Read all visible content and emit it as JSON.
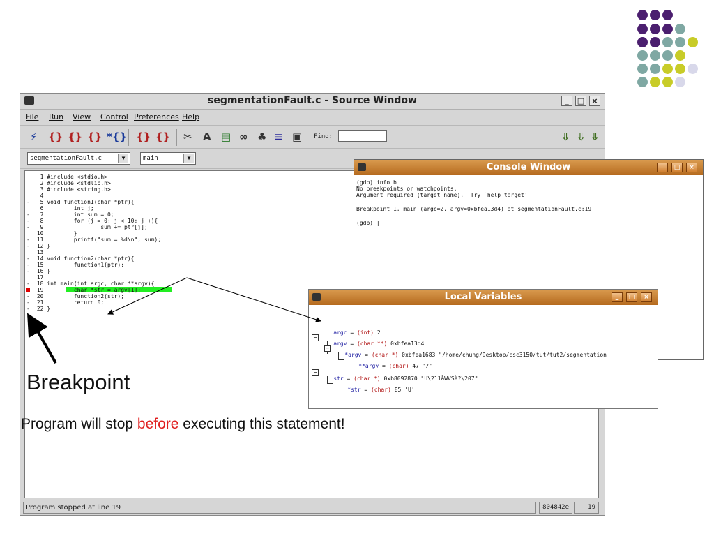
{
  "decor": {
    "colors": {
      "purple": "#4b1f6f",
      "teal": "#7fa8a3",
      "lime": "#c8cc28",
      "lavender": "#d8d8ea"
    }
  },
  "source_window": {
    "title": "segmentationFault.c - Source Window",
    "menu": [
      "File",
      "Run",
      "View",
      "Control",
      "Preferences",
      "Help"
    ],
    "find_label": "Find:",
    "file_combo": "segmentationFault.c",
    "function_combo": "main",
    "code": [
      {
        "marker": "",
        "text": "  1 #include <stdio.h>"
      },
      {
        "marker": "",
        "text": "  2 #include <stdlib.h>"
      },
      {
        "marker": "",
        "text": "  3 #include <string.h>"
      },
      {
        "marker": "",
        "text": "  4"
      },
      {
        "marker": "-",
        "text": "  5 void function1(char *ptr){"
      },
      {
        "marker": "",
        "text": "  6         int j;"
      },
      {
        "marker": "-",
        "text": "  7         int sum = 0;"
      },
      {
        "marker": "-",
        "text": "  8         for (j = 0; j < 10; j++){"
      },
      {
        "marker": "-",
        "text": "  9                 sum += ptr[j];"
      },
      {
        "marker": "",
        "text": " 10         }"
      },
      {
        "marker": "-",
        "text": " 11         printf(\"sum = %d\\n\", sum);"
      },
      {
        "marker": "-",
        "text": " 12 }"
      },
      {
        "marker": "",
        "text": " 13"
      },
      {
        "marker": "-",
        "text": " 14 void function2(char *ptr){"
      },
      {
        "marker": "-",
        "text": " 15         function1(ptr);"
      },
      {
        "marker": "-",
        "text": " 16 }"
      },
      {
        "marker": "",
        "text": " 17"
      },
      {
        "marker": "-",
        "text": " 18 int main(int argc, char **argv){"
      },
      {
        "marker": "bp",
        "text": " 19         char *str = argv[1];"
      },
      {
        "marker": "-",
        "text": " 20         function2(str);"
      },
      {
        "marker": "-",
        "text": " 21         return 0;"
      },
      {
        "marker": "-",
        "text": " 22 }"
      }
    ],
    "status_text": "Program stopped at line 19",
    "status_addr": "804842e",
    "status_line": "19"
  },
  "console_window": {
    "title": "Console Window",
    "lines": [
      "(gdb) info b",
      "No breakpoints or watchpoints.",
      "Argument required (target name).  Try `help target'",
      "",
      "Breakpoint 1, main (argc=2, argv=0xbfea13d4) at segmentationFault.c:19",
      "",
      "(gdb) |"
    ]
  },
  "locals_window": {
    "title": "Local Variables",
    "vars": [
      {
        "name": "argc",
        "type": "(int)",
        "value": "2"
      },
      {
        "name": "argv",
        "type": "(char **)",
        "value": "0xbfea13d4"
      },
      {
        "name": "*argv",
        "type": "(char *)",
        "value": "0xbfea1683 \"/home/chung/Desktop/csc3150/tut/tut2/segmentation"
      },
      {
        "name": "**argv",
        "type": "(char)",
        "value": "47 '/'"
      },
      {
        "name": "str",
        "type": "(char *)",
        "value": "0xb8092870 \"U\\211åWVSè?\\207\""
      },
      {
        "name": "*str",
        "type": "(char)",
        "value": "85 'U'"
      }
    ]
  },
  "annotation": {
    "breakpoint_label": "Breakpoint",
    "caption_pre": "Program will stop ",
    "caption_em": "before",
    "caption_post": " executing this statement!"
  }
}
